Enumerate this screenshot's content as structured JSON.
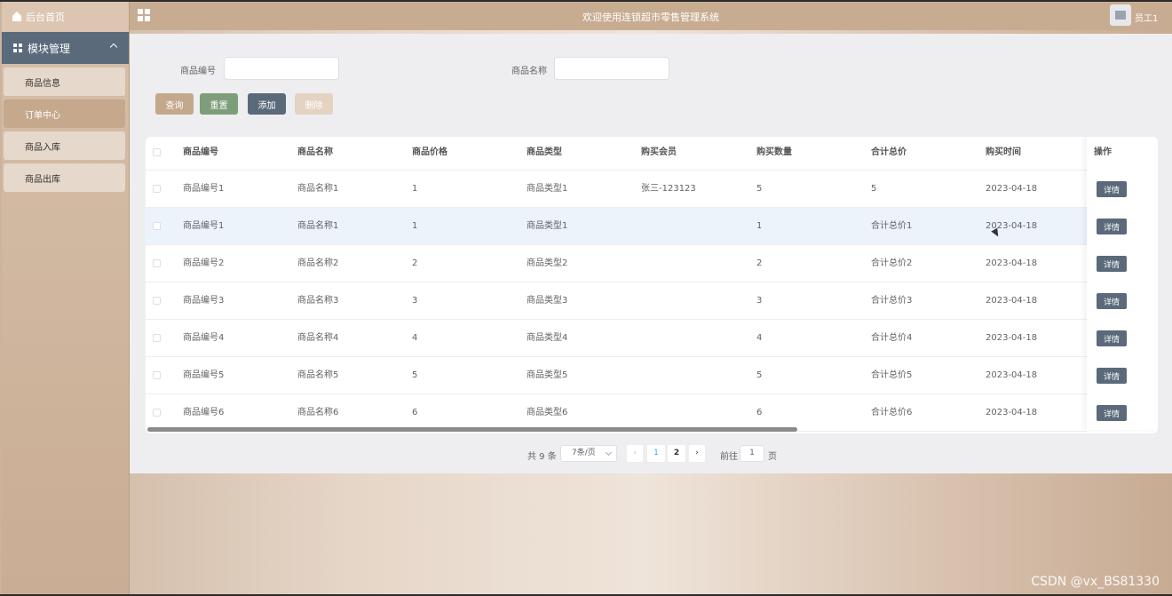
{
  "sidebar": {
    "home_label": "后台首页",
    "module_label": "模块管理",
    "items": [
      {
        "label": "商品信息",
        "active": false
      },
      {
        "label": "订单中心",
        "active": true
      },
      {
        "label": "商品入库",
        "active": false
      },
      {
        "label": "商品出库",
        "active": false
      }
    ]
  },
  "header": {
    "title": "欢迎使用连锁超市零售管理系统",
    "user": "员工1"
  },
  "search": {
    "code_label": "商品编号",
    "code_value": "",
    "name_label": "商品名称",
    "name_value": ""
  },
  "buttons": {
    "query": "查询",
    "reset": "重置",
    "add": "添加",
    "delete": "删除"
  },
  "colors": {
    "query": "#c3a88c",
    "reset": "#7e9e7a",
    "add": "#5a6a7a",
    "delete": "#e4d3c2"
  },
  "table": {
    "headers": [
      "商品编号",
      "商品名称",
      "商品价格",
      "商品类型",
      "购买会员",
      "购买数量",
      "合计总价",
      "购买时间"
    ],
    "op_header": "操作",
    "detail_label": "详情",
    "rows": [
      [
        "商品编号1",
        "商品名称1",
        "1",
        "商品类型1",
        "张三-123123",
        "5",
        "5",
        "2023-04-18"
      ],
      [
        "商品编号1",
        "商品名称1",
        "1",
        "商品类型1",
        "",
        "1",
        "合计总价1",
        "2023-04-18"
      ],
      [
        "商品编号2",
        "商品名称2",
        "2",
        "商品类型2",
        "",
        "2",
        "合计总价2",
        "2023-04-18"
      ],
      [
        "商品编号3",
        "商品名称3",
        "3",
        "商品类型3",
        "",
        "3",
        "合计总价3",
        "2023-04-18"
      ],
      [
        "商品编号4",
        "商品名称4",
        "4",
        "商品类型4",
        "",
        "4",
        "合计总价4",
        "2023-04-18"
      ],
      [
        "商品编号5",
        "商品名称5",
        "5",
        "商品类型5",
        "",
        "5",
        "合计总价5",
        "2023-04-18"
      ],
      [
        "商品编号6",
        "商品名称6",
        "6",
        "商品类型6",
        "",
        "6",
        "合计总价6",
        "2023-04-18"
      ]
    ]
  },
  "pagination": {
    "total": "共 9 条",
    "page_size": "7条/页",
    "pages": [
      "1",
      "2"
    ],
    "current_page": "1",
    "goto_label": "前往",
    "goto_value": "1",
    "page_suffix": "页"
  },
  "watermark": "CSDN @vx_BS81330"
}
